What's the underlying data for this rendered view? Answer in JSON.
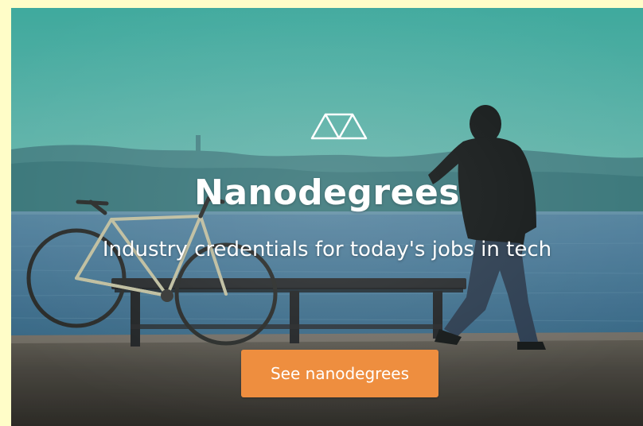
{
  "banner": {
    "title": "Nanodegrees",
    "subtitle": "Industry credentials for today's jobs in tech",
    "cta_label": "See nanodegrees",
    "logo_icon": "nanodegree-triangles-icon"
  },
  "colors": {
    "frame_background": "#fffdc8",
    "sky_top": "#4fbcae",
    "sky_bottom": "#8fcac3",
    "water": "#4e7f9e",
    "cta": "#ee8e3f",
    "text": "#ffffff"
  }
}
